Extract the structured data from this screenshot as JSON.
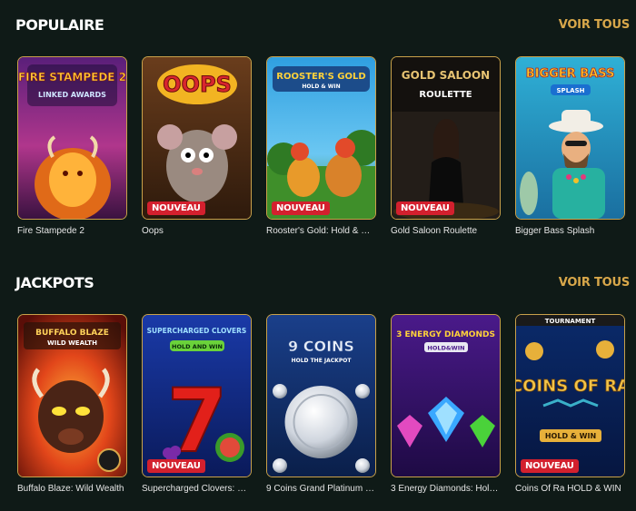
{
  "sections": {
    "popular": {
      "title": "POPULAIRE",
      "see_all": "VOIR TOUS",
      "games": [
        {
          "name": "Fire Stampede 2",
          "art_title": "FIRE STAMPEDE 2",
          "art_sub": "LINKED AWARDS",
          "badge": ""
        },
        {
          "name": "Oops",
          "art_title": "OOPS",
          "badge": "NOUVEAU"
        },
        {
          "name": "Rooster's Gold: Hold & Win",
          "art_title": "ROOSTER'S GOLD",
          "art_sub": "HOLD & WIN",
          "badge": "NOUVEAU"
        },
        {
          "name": "Gold Saloon Roulette",
          "art_title": "GOLD SALOON",
          "art_sub": "ROULETTE",
          "badge": "NOUVEAU"
        },
        {
          "name": "Bigger Bass Splash",
          "art_title": "BIGGER BASS",
          "art_sub": "SPLASH",
          "badge": ""
        }
      ]
    },
    "jackpots": {
      "title": "JACKPOTS",
      "see_all": "VOIR TOUS",
      "games": [
        {
          "name": "Buffalo Blaze: Wild Wealth",
          "art_title": "BUFFALO BLAZE",
          "art_sub": "WILD WEALTH",
          "badge": ""
        },
        {
          "name": "Supercharged Clovers: Hold a...",
          "art_title": "SUPERCHARGED CLOVERS",
          "art_sub": "HOLD AND WIN",
          "badge": "NOUVEAU"
        },
        {
          "name": "9 Coins Grand Platinum Editi...",
          "art_title": "9 COINS",
          "art_sub": "HOLD THE JACKPOT",
          "badge": ""
        },
        {
          "name": "3 Energy Diamonds: Hold & ...",
          "art_title": "3 ENERGY DIAMONDS",
          "art_sub": "HOLD&WIN",
          "badge": ""
        },
        {
          "name": "Coins Of Ra HOLD & WIN",
          "art_title": "COINS OF RA",
          "art_sub": "HOLD & WIN",
          "art_top": "TOURNAMENT",
          "badge": "NOUVEAU"
        }
      ]
    }
  },
  "colors": {
    "background": "#0f1a17",
    "accent_gold": "#d8a74a",
    "badge_red": "#d3202e"
  }
}
